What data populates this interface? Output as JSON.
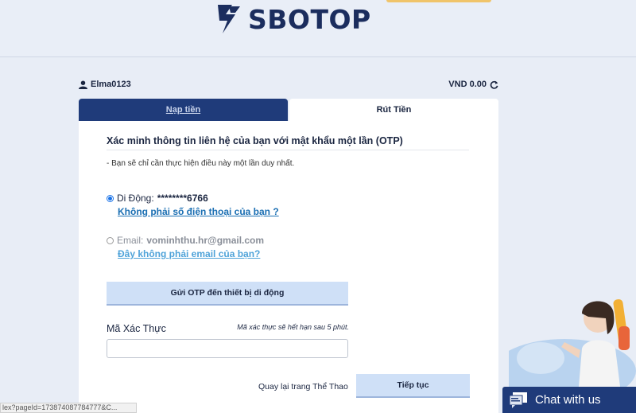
{
  "brand": {
    "name": "SBOTOP",
    "icon": "lightning-bolt-logo"
  },
  "user": {
    "username": "Elma0123",
    "balance": "VND 0.00"
  },
  "tabs": [
    {
      "label": "Nạp tiền"
    },
    {
      "label": "Rút Tiền"
    }
  ],
  "verify": {
    "title": "Xác minh thông tin liên hệ của bạn với mật khẩu một lần (OTP)",
    "note": "- Bạn sẽ chỉ cần thực hiện điều này một lần duy nhất.",
    "mobile_label": "Di Động:",
    "mobile_value": "********6766",
    "mobile_link": "Không phải số điện thoại của bạn ?",
    "email_label": "Email:",
    "email_value": "vominhthu.hr@gmail.com",
    "email_link": "Đây không phải email của bạn?",
    "send_button": "Gửi OTP đến thiết bị di động",
    "code_label": "Mã Xác Thực",
    "code_hint": "Mã xác thực sẽ hết hạn sau 5 phút.",
    "back_link": "Quay lại trang Thể Thao",
    "continue_button": "Tiếp tục"
  },
  "status_url": "lex?pageId=173874087784777&C...",
  "chat": {
    "label": "Chat with us"
  },
  "colors": {
    "navy": "#1f3b7a",
    "button": "#cfe0f7",
    "link": "#1b6fb3",
    "radio": "#1a73e8"
  }
}
